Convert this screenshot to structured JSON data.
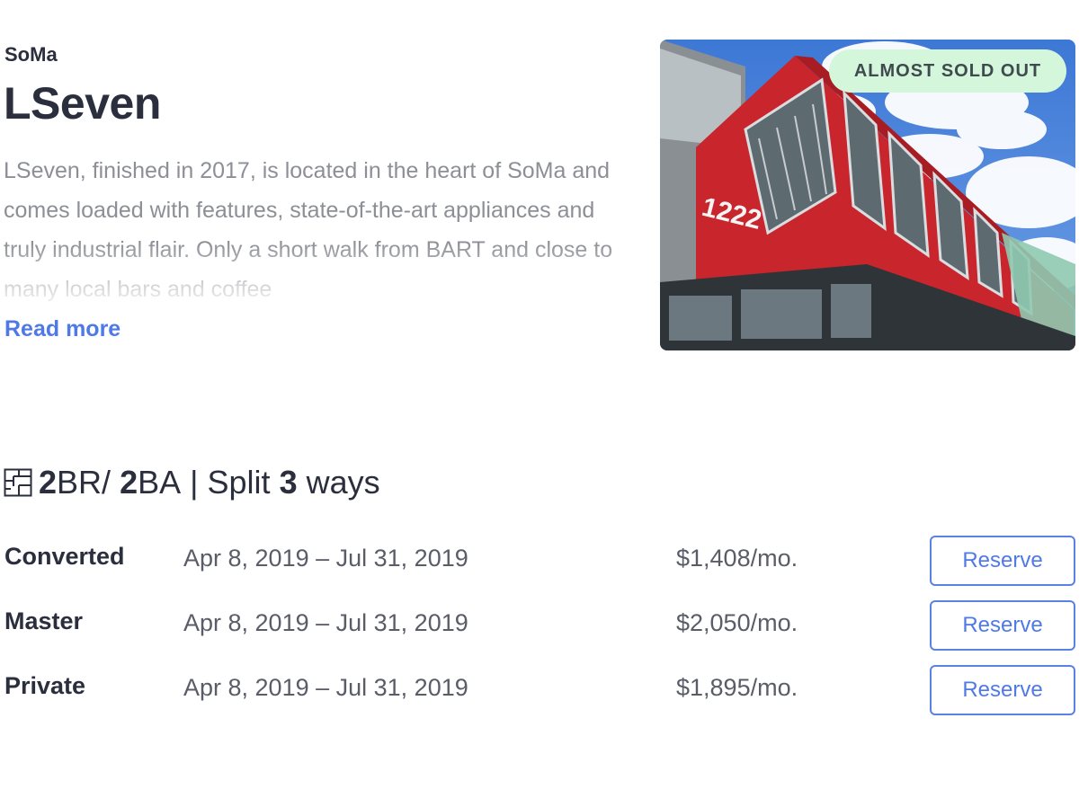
{
  "listing": {
    "neighborhood": "SoMa",
    "title": "LSeven",
    "description": "LSeven, finished in 2017, is located in the heart of SoMa and comes loaded with features, state-of-the-art appliances and truly industrial flair. Only a short walk from BART and close to many local bars and coffee",
    "read_more": "Read more",
    "badge": "ALMOST SOLD OUT",
    "building_number": "1222"
  },
  "unit": {
    "bedrooms": "2",
    "br_suffix": "BR/",
    "bathrooms": "2",
    "ba_suffix": "BA",
    "separator": "|",
    "split_prefix": "Split",
    "split_count": "3",
    "split_suffix": "ways",
    "icon": "floor-plan-icon"
  },
  "rooms": [
    {
      "name": "Converted",
      "dates": "Apr 8, 2019 – Jul 31, 2019",
      "price": "$1,408/mo.",
      "button": "Reserve"
    },
    {
      "name": "Master",
      "dates": "Apr 8, 2019 – Jul 31, 2019",
      "price": "$2,050/mo.",
      "button": "Reserve"
    },
    {
      "name": "Private",
      "dates": "Apr 8, 2019 – Jul 31, 2019",
      "price": "$1,895/mo.",
      "button": "Reserve"
    }
  ],
  "colors": {
    "accent": "#4f7ae6",
    "badge_bg": "#d4f7dc",
    "building_red": "#c8252d",
    "sky": "#4a82d8"
  }
}
